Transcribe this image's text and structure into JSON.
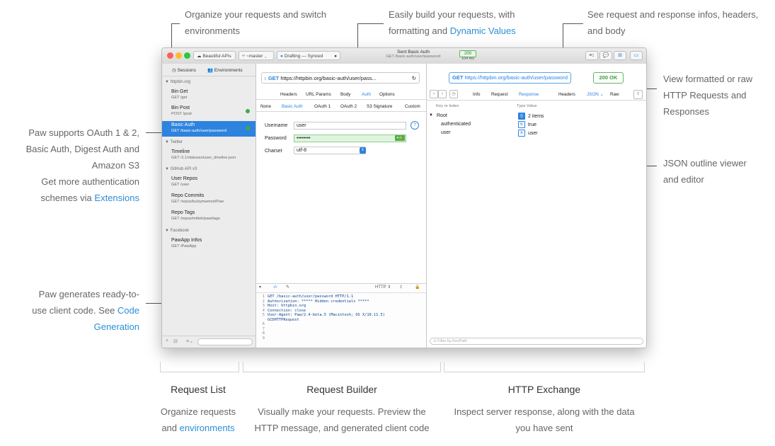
{
  "top_captions": {
    "organize": [
      "Organize your requests and switch",
      "environments"
    ],
    "build": [
      "Easily build your requests, with",
      "formatting and "
    ],
    "build_link": "Dynamic Values",
    "infos": [
      "See request and response infos, headers,",
      "and body"
    ]
  },
  "right_captions": {
    "view": [
      "View formatted or raw",
      "HTTP Requests and",
      "Responses"
    ],
    "json": [
      "JSON outline viewer",
      "and editor"
    ]
  },
  "left_captions": {
    "oauth": [
      "Paw supports OAuth 1 & 2,",
      "Basic Auth, Digest Auth and",
      "Amazon S3"
    ],
    "more": [
      "Get more authentication",
      "schemes via "
    ],
    "more_link": "Extensions",
    "codegen": [
      "Paw generates ready-to-",
      "use client code. See "
    ],
    "codegen_link1": "Code",
    "codegen_link2": "Generation"
  },
  "window": {
    "toolbar": {
      "project": "Beautiful APIs",
      "branch": "~master",
      "sync": "Drafting — Synced",
      "title": "Sent Basic Auth",
      "subtitle": "GET /basic-auth/user/password",
      "status": "200",
      "time": "104 ms"
    },
    "sidebar": {
      "tab_sessions": "Sessions",
      "tab_environments": "Environments",
      "groups": [
        "httpbin.org",
        "Twitter",
        "GitHub API v3",
        "Facebook"
      ],
      "items": [
        {
          "name": "Bin Get",
          "path": "GET /get"
        },
        {
          "name": "Bin Post",
          "path": "POST /post"
        },
        {
          "name": "Basic Auth",
          "path": "GET /basic-auth/user/password"
        },
        {
          "name": "Timeline",
          "path": "GET /1.1/statuses/user_timeline.json"
        },
        {
          "name": "User Repos",
          "path": "GET /user"
        },
        {
          "name": "Repo Commits",
          "path": "GET /repos/luckymarmot/Paw"
        },
        {
          "name": "Repo Tags",
          "path": "GET /repos/mittsh/paw/tags"
        },
        {
          "name": "PawApp Infos",
          "path": "GET /PawApp"
        }
      ]
    },
    "builder": {
      "method": "GET",
      "url": "https://httpbin.org/basic-auth/user/pass...",
      "tabs": [
        "Headers",
        "URL Params",
        "Body",
        "Auth",
        "Options"
      ],
      "auth_tabs": [
        "None",
        "Basic Auth",
        "OAuth 1",
        "OAuth 2",
        "S3 Signature",
        "Custom"
      ],
      "username_label": "Username",
      "username_value": "user",
      "password_label": "Password",
      "password_value": "••••••••",
      "charset_label": "Charset",
      "charset_value": "utf-8",
      "code_format": "HTTP",
      "code_lines": [
        "GET /basic-auth/user/password HTTP/1.1",
        "Authorization: ***** Hidden credentials *****",
        "Host: httpbin.org",
        "Connection: close",
        "User-Agent: Paw/2.4-beta.5 (Macintosh; OS X/10.11.5)",
        "GCDHTTPRequest",
        "",
        "",
        ""
      ],
      "code_line_numbers": [
        "1",
        "2",
        "3",
        "4",
        "5",
        "",
        "6",
        "7",
        "8",
        "9"
      ]
    },
    "exchange": {
      "method": "GET",
      "url": "https://httpbin.org/basic-auth/user/password",
      "status": "200 OK",
      "tabs": [
        "Info",
        "Request",
        "Response",
        "Headers",
        "JSON",
        "Raw"
      ],
      "col_key": "Key or Index",
      "col_type_value": "Type Value",
      "rows": [
        {
          "key": "Root",
          "type": "{}",
          "value": "2 items"
        },
        {
          "key": "authenticated",
          "type": "B",
          "value": "true"
        },
        {
          "key": "user",
          "type": "A",
          "value": "user"
        }
      ],
      "filter_placeholder": "Filter by KeyPath"
    }
  },
  "sections": [
    {
      "title": "Request List",
      "desc": [
        "Organize requests",
        "and "
      ],
      "link": "environments"
    },
    {
      "title": "Request Builder",
      "desc": [
        "Visually make your requests. Preview the",
        "HTTP message, and generated client code"
      ],
      "link": ""
    },
    {
      "title": "HTTP Exchange",
      "desc": [
        "Inspect server response, along with the data",
        "you have sent"
      ],
      "link": ""
    }
  ]
}
